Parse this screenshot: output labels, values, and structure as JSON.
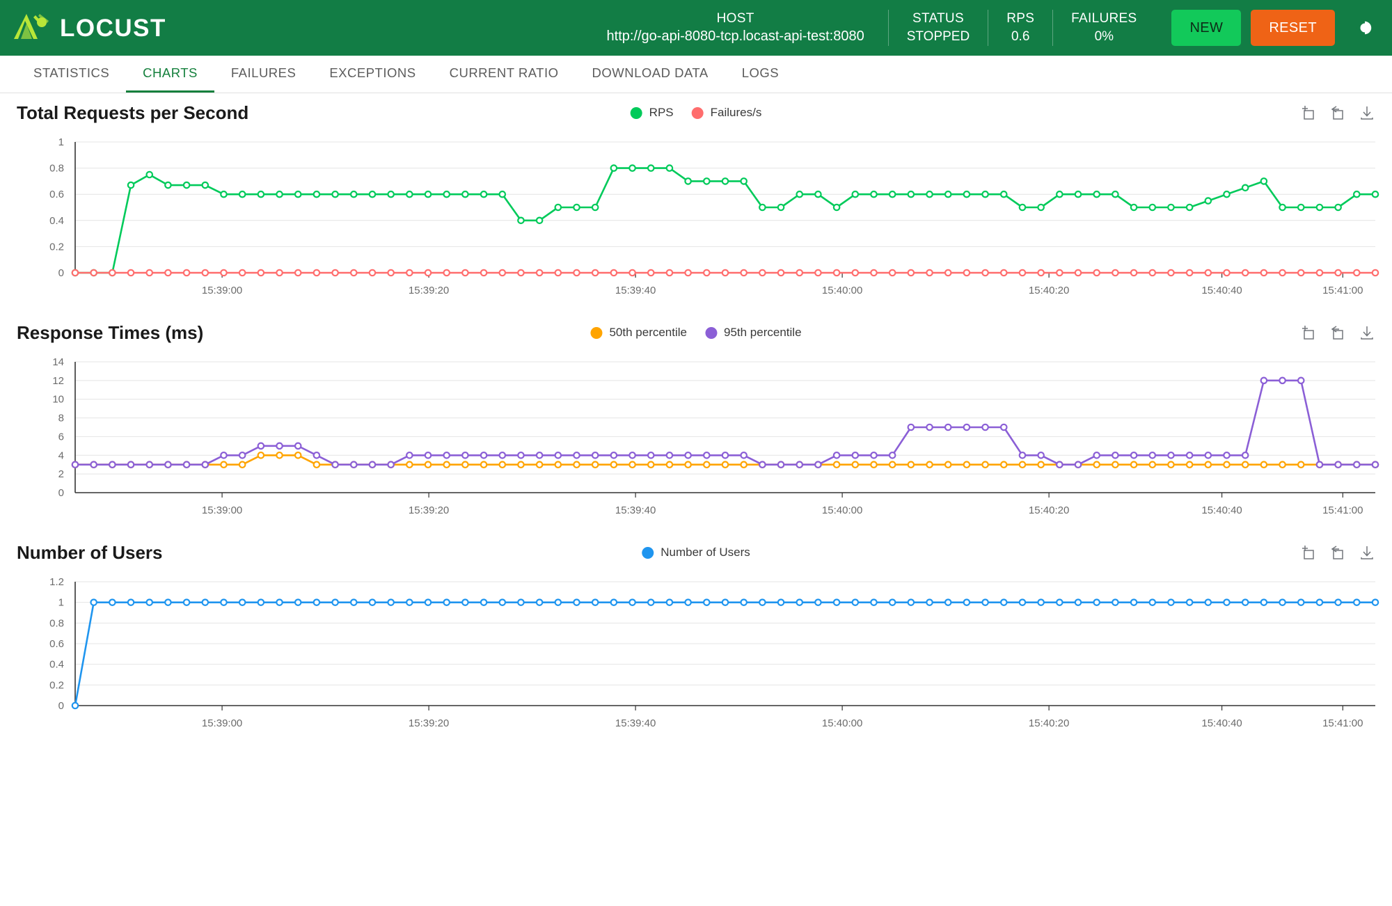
{
  "header": {
    "brand": "LOCUST",
    "logo_icon": "locust-logo-icon",
    "host_label": "HOST",
    "host_value": "http://go-api-8080-tcp.locast-api-test:8080",
    "status_label": "STATUS",
    "status_value": "STOPPED",
    "rps_label": "RPS",
    "rps_value": "0.6",
    "failures_label": "FAILURES",
    "failures_value": "0%",
    "new_button": "NEW",
    "reset_button": "RESET",
    "theme_toggle_icon": "dark-mode-toggle-icon",
    "colors": {
      "header_bg": "#127d45",
      "new_button": "#12c95a",
      "reset_button": "#ef6316"
    }
  },
  "tabs": [
    {
      "label": "STATISTICS",
      "active": false
    },
    {
      "label": "CHARTS",
      "active": true
    },
    {
      "label": "FAILURES",
      "active": false
    },
    {
      "label": "EXCEPTIONS",
      "active": false
    },
    {
      "label": "CURRENT RATIO",
      "active": false
    },
    {
      "label": "DOWNLOAD DATA",
      "active": false
    },
    {
      "label": "LOGS",
      "active": false
    }
  ],
  "chart_tools": [
    {
      "name": "data-zoom-icon",
      "label": "Data Zoom"
    },
    {
      "name": "restore-icon",
      "label": "Restore"
    },
    {
      "name": "save-image-icon",
      "label": "Save as Image"
    }
  ],
  "chart_data": [
    {
      "type": "line",
      "id": "total-requests-per-second",
      "title": "Total Requests per Second",
      "xlabel": "",
      "ylabel": "",
      "ylim": [
        0,
        1
      ],
      "yticks": [
        0,
        0.2,
        0.4,
        0.6,
        0.8,
        1
      ],
      "ytick_labels": [
        "0",
        "0.2",
        "0.4",
        "0.6",
        "0.8",
        "1"
      ],
      "xticks": [
        "15:39:00",
        "15:39:20",
        "15:39:40",
        "15:40:00",
        "15:40:20",
        "15:40:40",
        "15:41:00"
      ],
      "xtick_positions": [
        0.113,
        0.272,
        0.431,
        0.59,
        0.749,
        0.882,
        0.975
      ],
      "grid": true,
      "legend_position": "top-center",
      "series": [
        {
          "name": "RPS",
          "color": "#00ca5a",
          "values": [
            0,
            0,
            0,
            0.67,
            0.75,
            0.67,
            0.67,
            0.67,
            0.6,
            0.6,
            0.6,
            0.6,
            0.6,
            0.6,
            0.6,
            0.6,
            0.6,
            0.6,
            0.6,
            0.6,
            0.6,
            0.6,
            0.6,
            0.6,
            0.4,
            0.4,
            0.5,
            0.5,
            0.5,
            0.8,
            0.8,
            0.8,
            0.8,
            0.7,
            0.7,
            0.7,
            0.7,
            0.5,
            0.5,
            0.6,
            0.6,
            0.5,
            0.6,
            0.6,
            0.6,
            0.6,
            0.6,
            0.6,
            0.6,
            0.6,
            0.6,
            0.5,
            0.5,
            0.6,
            0.6,
            0.6,
            0.6,
            0.5,
            0.5,
            0.5,
            0.5,
            0.55,
            0.6,
            0.65,
            0.7,
            0.5,
            0.5,
            0.5,
            0.5,
            0.6,
            0.6
          ]
        },
        {
          "name": "Failures/s",
          "color": "#ff6d6d",
          "values": [
            0,
            0,
            0,
            0,
            0,
            0,
            0,
            0,
            0,
            0,
            0,
            0,
            0,
            0,
            0,
            0,
            0,
            0,
            0,
            0,
            0,
            0,
            0,
            0,
            0,
            0,
            0,
            0,
            0,
            0,
            0,
            0,
            0,
            0,
            0,
            0,
            0,
            0,
            0,
            0,
            0,
            0,
            0,
            0,
            0,
            0,
            0,
            0,
            0,
            0,
            0,
            0,
            0,
            0,
            0,
            0,
            0,
            0,
            0,
            0,
            0,
            0,
            0,
            0,
            0,
            0,
            0,
            0,
            0,
            0,
            0
          ]
        }
      ]
    },
    {
      "type": "line",
      "id": "response-times",
      "title": "Response Times (ms)",
      "xlabel": "",
      "ylabel": "",
      "ylim": [
        0,
        14
      ],
      "yticks": [
        0,
        2,
        4,
        6,
        8,
        10,
        12,
        14
      ],
      "ytick_labels": [
        "0",
        "2",
        "4",
        "6",
        "8",
        "10",
        "12",
        "14"
      ],
      "xticks": [
        "15:39:00",
        "15:39:20",
        "15:39:40",
        "15:40:00",
        "15:40:20",
        "15:40:40",
        "15:41:00"
      ],
      "xtick_positions": [
        0.113,
        0.272,
        0.431,
        0.59,
        0.749,
        0.882,
        0.975
      ],
      "grid": true,
      "legend_position": "top-center",
      "series": [
        {
          "name": "50th percentile",
          "color": "#ffa400",
          "values": [
            3,
            3,
            3,
            3,
            3,
            3,
            3,
            3,
            3,
            3,
            4,
            4,
            4,
            3,
            3,
            3,
            3,
            3,
            3,
            3,
            3,
            3,
            3,
            3,
            3,
            3,
            3,
            3,
            3,
            3,
            3,
            3,
            3,
            3,
            3,
            3,
            3,
            3,
            3,
            3,
            3,
            3,
            3,
            3,
            3,
            3,
            3,
            3,
            3,
            3,
            3,
            3,
            3,
            3,
            3,
            3,
            3,
            3,
            3,
            3,
            3,
            3,
            3,
            3,
            3,
            3,
            3,
            3,
            3,
            3,
            3
          ]
        },
        {
          "name": "95th percentile",
          "color": "#8b5fd6",
          "values": [
            3,
            3,
            3,
            3,
            3,
            3,
            3,
            3,
            4,
            4,
            5,
            5,
            5,
            4,
            3,
            3,
            3,
            3,
            4,
            4,
            4,
            4,
            4,
            4,
            4,
            4,
            4,
            4,
            4,
            4,
            4,
            4,
            4,
            4,
            4,
            4,
            4,
            3,
            3,
            3,
            3,
            4,
            4,
            4,
            4,
            7,
            7,
            7,
            7,
            7,
            7,
            4,
            4,
            3,
            3,
            4,
            4,
            4,
            4,
            4,
            4,
            4,
            4,
            4,
            12,
            12,
            12,
            3,
            3,
            3,
            3
          ]
        }
      ]
    },
    {
      "type": "line",
      "id": "number-of-users",
      "title": "Number of Users",
      "xlabel": "",
      "ylabel": "",
      "ylim": [
        0,
        1.2
      ],
      "yticks": [
        0,
        0.2,
        0.4,
        0.6,
        0.8,
        1,
        1.2
      ],
      "ytick_labels": [
        "0",
        "0.2",
        "0.4",
        "0.6",
        "0.8",
        "1",
        "1.2"
      ],
      "xticks": [
        "15:39:00",
        "15:39:20",
        "15:39:40",
        "15:40:00",
        "15:40:20",
        "15:40:40",
        "15:41:00"
      ],
      "xtick_positions": [
        0.113,
        0.272,
        0.431,
        0.59,
        0.749,
        0.882,
        0.975
      ],
      "grid": true,
      "legend_position": "top-center",
      "series": [
        {
          "name": "Number of Users",
          "color": "#1f95ef",
          "values": [
            0,
            1,
            1,
            1,
            1,
            1,
            1,
            1,
            1,
            1,
            1,
            1,
            1,
            1,
            1,
            1,
            1,
            1,
            1,
            1,
            1,
            1,
            1,
            1,
            1,
            1,
            1,
            1,
            1,
            1,
            1,
            1,
            1,
            1,
            1,
            1,
            1,
            1,
            1,
            1,
            1,
            1,
            1,
            1,
            1,
            1,
            1,
            1,
            1,
            1,
            1,
            1,
            1,
            1,
            1,
            1,
            1,
            1,
            1,
            1,
            1,
            1,
            1,
            1,
            1,
            1,
            1,
            1,
            1,
            1,
            1
          ]
        }
      ]
    }
  ]
}
